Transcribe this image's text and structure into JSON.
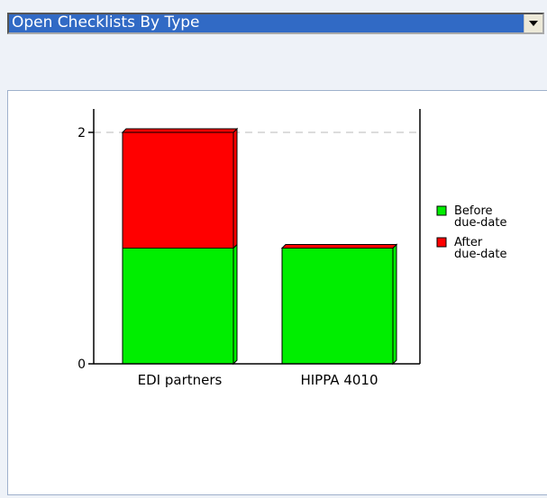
{
  "dropdown": {
    "selected": "Open Checklists By Type"
  },
  "chart_data": {
    "type": "bar",
    "stacked": true,
    "categories": [
      "EDI partners",
      "HIPPA 4010"
    ],
    "series": [
      {
        "name": "Before due-date",
        "color": "#00ee00",
        "values": [
          1,
          1
        ]
      },
      {
        "name": "After due-date",
        "color": "#ff0000",
        "values": [
          1,
          0
        ]
      }
    ],
    "yticks": [
      0,
      2
    ],
    "ylim": [
      0,
      2
    ],
    "grid": "dashed line at 2",
    "legend": "right",
    "legend_lines": [
      [
        "Before",
        "due-date"
      ],
      [
        "After",
        "due-date"
      ]
    ]
  }
}
